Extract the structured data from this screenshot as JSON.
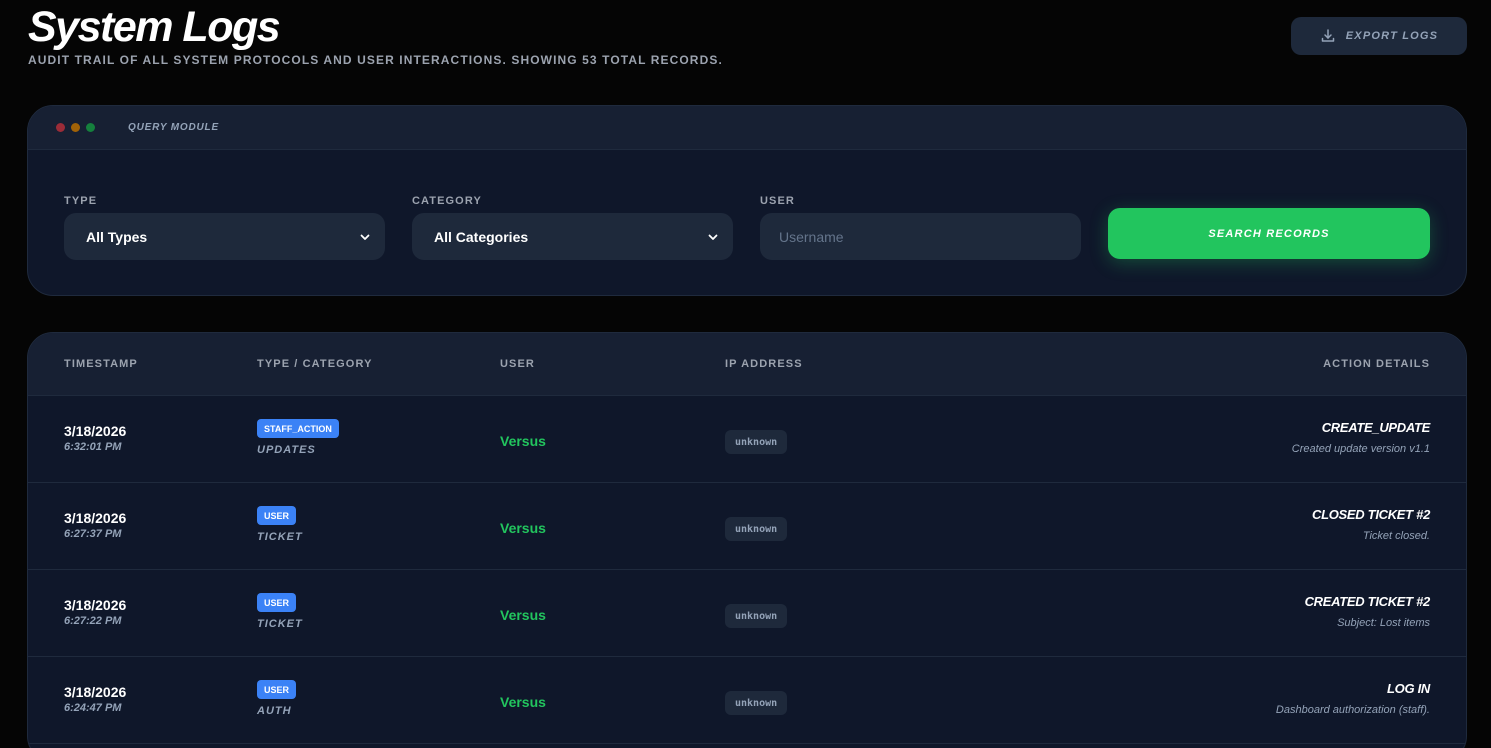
{
  "header": {
    "title": "System Logs",
    "subtitle": "AUDIT TRAIL OF ALL SYSTEM PROTOCOLS AND USER INTERACTIONS. SHOWING 53 TOTAL RECORDS.",
    "export_label": "EXPORT LOGS"
  },
  "query": {
    "module_label": "QUERY MODULE",
    "type_label": "TYPE",
    "type_value": "All Types",
    "category_label": "CATEGORY",
    "category_value": "All Categories",
    "user_label": "USER",
    "user_placeholder": "Username",
    "search_label": "SEARCH RECORDS"
  },
  "table": {
    "columns": [
      "TIMESTAMP",
      "TYPE / CATEGORY",
      "USER",
      "IP ADDRESS",
      "ACTION DETAILS"
    ],
    "rows": [
      {
        "date": "3/18/2026",
        "time": "6:32:01 PM",
        "type": "STAFF_ACTION",
        "category": "UPDATES",
        "user": "Versus",
        "ip": "unknown",
        "action": "CREATE_UPDATE",
        "detail": "Created update version v1.1"
      },
      {
        "date": "3/18/2026",
        "time": "6:27:37 PM",
        "type": "USER",
        "category": "TICKET",
        "user": "Versus",
        "ip": "unknown",
        "action": "CLOSED TICKET #2",
        "detail": "Ticket closed."
      },
      {
        "date": "3/18/2026",
        "time": "6:27:22 PM",
        "type": "USER",
        "category": "TICKET",
        "user": "Versus",
        "ip": "unknown",
        "action": "CREATED TICKET #2",
        "detail": "Subject: Lost items"
      },
      {
        "date": "3/18/2026",
        "time": "6:24:47 PM",
        "type": "USER",
        "category": "AUTH",
        "user": "Versus",
        "ip": "unknown",
        "action": "LOG IN",
        "detail": "Dashboard authorization (staff)."
      }
    ]
  },
  "colors": {
    "accent_green": "#22c55e",
    "badge_blue": "#3b82f6",
    "panel_bg": "#0f172a",
    "page_bg": "#050505"
  }
}
